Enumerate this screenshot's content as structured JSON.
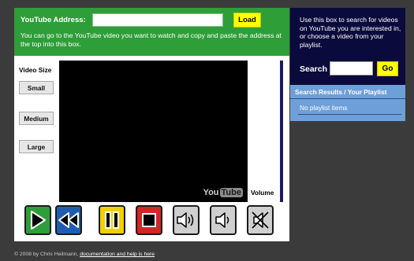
{
  "address_bar": {
    "label": "YouTube Address:",
    "input_value": "",
    "load_label": "Load",
    "hint": "You can go to the YouTube video you want to watch and copy and paste the address at the top into this box."
  },
  "video_size": {
    "label": "Video Size",
    "small_label": "Small",
    "medium_label": "Medium",
    "large_label": "Large"
  },
  "player": {
    "logo_you": "You",
    "logo_tube": "Tube",
    "volume_label": "Volume"
  },
  "controls": {
    "play_color": "#2f9e3a",
    "rewind_color": "#1f5db3",
    "pause_color": "#f2d000",
    "stop_color": "#d42525",
    "volume_color": "#cfcfcf"
  },
  "sidebar": {
    "hint": "Use this box to search for videos on YouTube you are interested in, or choose a video from your playlist.",
    "search_label": "Search",
    "search_value": "",
    "go_label": "Go",
    "results_title": "Search Results / Your Playlist",
    "playlist_empty": "No playlist items"
  },
  "footer": {
    "credit": "© 2008 by Chris Heilmann,",
    "link": "documentation and help is here"
  }
}
